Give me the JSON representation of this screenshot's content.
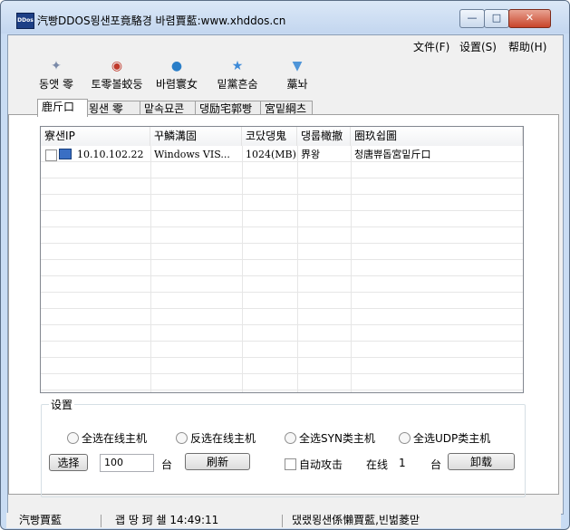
{
  "window": {
    "app_icon_label": "DDos",
    "title": "汽빵DDOS묑샌포竟駱경 바렴賈藍:www.xhddos.cn",
    "min_glyph": "—",
    "max_glyph": "□",
    "close_glyph": "✕"
  },
  "menu": [
    "文件(F)",
    "设置(S)",
    "帮助(H)"
  ],
  "toolbar": [
    {
      "label": "동앳  零",
      "icon": "satellite-icon"
    },
    {
      "label": "토零볼蛟둥",
      "icon": "trojan-icon"
    },
    {
      "label": "바렴寰女",
      "icon": "globe-icon"
    },
    {
      "label": "밑黨흔숨",
      "icon": "star-icon"
    },
    {
      "label": "藁놔",
      "icon": "exit-icon"
    }
  ],
  "tabs": [
    "鹿斤口",
    "묑샌  零",
    "맡속묘콘",
    "댕励宅郭빵",
    "宮밑綱츠"
  ],
  "list": {
    "columns": [
      "寮샌IP",
      "꾸鱗溝固",
      "코닸댕鬼",
      "댕룹橄撤",
      "圈玖쉽圖"
    ],
    "rows": [
      {
        "ip": "10.10.102.22",
        "os": "Windows VIS...",
        "mem": "1024(MB)",
        "bw": "界왕",
        "note": "청唐쀼돕宮밑斤口"
      }
    ]
  },
  "settings": {
    "group_title": "设置",
    "radios": [
      "全选在线主机",
      "反选在线主机",
      "全选SYN类主机",
      "全选UDP类主机"
    ],
    "select_button": "选择",
    "count_value": "100",
    "unit_label": "台",
    "refresh_button": "刷新",
    "auto_attack_label": "自动攻击",
    "online_label": "在线",
    "online_count": "1",
    "online_unit": "台",
    "uninstall_button": "卸载"
  },
  "status": {
    "left": "汽빵賈藍",
    "middle": "괩 땅 珂 쇌 14:49:11",
    "right": "댔랬묑샌係懶賈藍,빈벎菱맏"
  }
}
